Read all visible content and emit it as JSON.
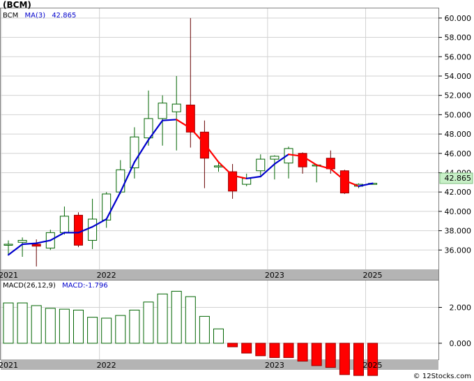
{
  "title": "(BCM)",
  "price_legend": {
    "series_label": "BCM",
    "ma_label": "MA(3)",
    "ma_value": "42.865"
  },
  "macd_legend": {
    "label": "MACD(26,12,9)",
    "value_label": "MACD:-1.796"
  },
  "last_price_tag": "42.865",
  "watermark": "© 12Stocks.com",
  "colors": {
    "up_candle": "#006400",
    "down_candle": "#ff0000",
    "ma_up": "#0000cc",
    "ma_down": "#ff0000",
    "price_tag_bg": "#c8f0c8",
    "year_band": "#b4b4b4",
    "grid": "#d2d2d2"
  },
  "chart_data": [
    {
      "type": "candlestick",
      "name": "price",
      "ylim": [
        34,
        61
      ],
      "y_ticks": [
        "36.000",
        "38.000",
        "40.000",
        "42.000",
        "44.000",
        "46.000",
        "48.000",
        "50.000",
        "52.000",
        "54.000",
        "56.000",
        "58.000",
        "60.000"
      ],
      "x_year_labels": [
        {
          "label": "2021",
          "bar": 0
        },
        {
          "label": "2022",
          "bar": 7
        },
        {
          "label": "2023",
          "bar": 19
        },
        {
          "label": "2025",
          "bar": 26
        }
      ],
      "candles": [
        {
          "open": 36.6,
          "high": 37.0,
          "low": 35.5,
          "close": 36.6
        },
        {
          "open": 36.8,
          "high": 37.3,
          "low": 35.3,
          "close": 37.0
        },
        {
          "open": 36.6,
          "high": 37.1,
          "low": 34.3,
          "close": 36.4
        },
        {
          "open": 36.2,
          "high": 38.1,
          "low": 36.0,
          "close": 37.8
        },
        {
          "open": 37.8,
          "high": 40.5,
          "low": 37.6,
          "close": 39.5
        },
        {
          "open": 39.6,
          "high": 39.9,
          "low": 36.3,
          "close": 36.5
        },
        {
          "open": 37.0,
          "high": 41.3,
          "low": 36.1,
          "close": 39.2
        },
        {
          "open": 39.1,
          "high": 42.0,
          "low": 38.3,
          "close": 41.8
        },
        {
          "open": 42.0,
          "high": 45.3,
          "low": 41.8,
          "close": 44.3
        },
        {
          "open": 44.5,
          "high": 48.7,
          "low": 43.4,
          "close": 47.7
        },
        {
          "open": 47.6,
          "high": 52.5,
          "low": 46.8,
          "close": 49.6
        },
        {
          "open": 49.6,
          "high": 52.0,
          "low": 46.8,
          "close": 51.2
        },
        {
          "open": 50.3,
          "high": 54.0,
          "low": 46.3,
          "close": 51.1
        },
        {
          "open": 51.0,
          "high": 60.0,
          "low": 46.6,
          "close": 48.2
        },
        {
          "open": 48.2,
          "high": 49.4,
          "low": 42.4,
          "close": 45.5
        },
        {
          "open": 44.7,
          "high": 45.1,
          "low": 44.1,
          "close": 44.7
        },
        {
          "open": 44.1,
          "high": 44.9,
          "low": 41.3,
          "close": 42.1
        },
        {
          "open": 42.8,
          "high": 43.9,
          "low": 42.6,
          "close": 43.4
        },
        {
          "open": 44.2,
          "high": 45.9,
          "low": 43.7,
          "close": 45.4
        },
        {
          "open": 45.4,
          "high": 45.8,
          "low": 43.3,
          "close": 45.7
        },
        {
          "open": 45.0,
          "high": 46.7,
          "low": 43.4,
          "close": 46.5
        },
        {
          "open": 46.0,
          "high": 46.1,
          "low": 43.9,
          "close": 44.6
        },
        {
          "open": 44.7,
          "high": 44.9,
          "low": 43.0,
          "close": 44.8
        },
        {
          "open": 45.5,
          "high": 46.3,
          "low": 43.9,
          "close": 44.4
        },
        {
          "open": 44.2,
          "high": 44.3,
          "low": 41.8,
          "close": 41.9
        },
        {
          "open": 42.6,
          "high": 42.9,
          "low": 42.4,
          "close": 42.8
        },
        {
          "open": 42.8,
          "high": 42.9,
          "low": 42.8,
          "close": 42.9
        }
      ],
      "ma": [
        35.5,
        36.6,
        36.7,
        37.0,
        37.8,
        37.8,
        38.4,
        39.2,
        42.0,
        45.1,
        47.4,
        49.4,
        49.5,
        48.6,
        47.0,
        45.1,
        43.7,
        43.4,
        43.6,
        44.9,
        45.9,
        45.7,
        44.8,
        44.4,
        43.2,
        42.6,
        42.9
      ]
    },
    {
      "type": "bar",
      "name": "macd",
      "ylim": [
        -0.9,
        3.5
      ],
      "y_ticks": [
        "0.000",
        "2.000"
      ],
      "values": [
        2.25,
        2.25,
        2.1,
        1.95,
        1.9,
        1.85,
        1.45,
        1.4,
        1.55,
        1.85,
        2.3,
        2.75,
        2.9,
        2.6,
        1.5,
        0.8,
        -0.2,
        -0.55,
        -0.7,
        -0.8,
        -0.8,
        -1.0,
        -1.25,
        -1.35,
        -1.75,
        -1.8,
        -1.8
      ]
    }
  ]
}
